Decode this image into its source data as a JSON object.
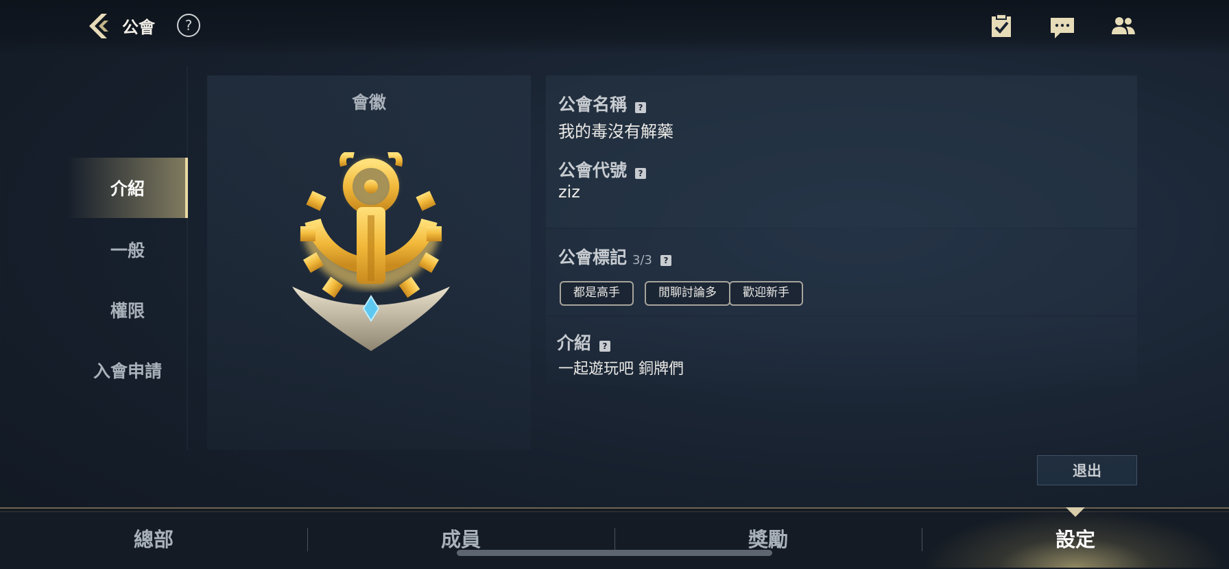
{
  "header": {
    "title": "公會",
    "help_label": "?",
    "icons": [
      "back-icon",
      "help-icon",
      "checklist-icon",
      "chat-icon",
      "friends-icon"
    ]
  },
  "sidebar": {
    "items": [
      {
        "label": "介紹",
        "active": true
      },
      {
        "label": "一般",
        "active": false
      },
      {
        "label": "權限",
        "active": false
      },
      {
        "label": "入會申請",
        "active": false
      }
    ]
  },
  "emblem": {
    "label": "會徽",
    "icon": "guild-emblem-icon",
    "colors": {
      "gold": "#f2b93b",
      "gem": "#5ec8f0",
      "silver": "#cfc6b0"
    }
  },
  "info": {
    "name_label": "公會名稱",
    "name_value": "我的毒沒有解藥",
    "tag_code_label": "公會代號",
    "tag_code_value": "ziz",
    "tags_label": "公會標記",
    "tags_count": "3/3",
    "tags": [
      "都是高手",
      "閒聊討論多",
      "歡迎新手"
    ],
    "intro_label": "介紹",
    "intro_value": "一起遊玩吧 銅牌們",
    "help_glyph": "?"
  },
  "actions": {
    "exit_label": "退出"
  },
  "bottom_tabs": [
    {
      "label": "總部",
      "active": false
    },
    {
      "label": "成員",
      "active": false
    },
    {
      "label": "獎勵",
      "active": false
    },
    {
      "label": "設定",
      "active": true
    }
  ],
  "colors": {
    "accent_gold": "#e9d9a3",
    "background": "#17202d"
  }
}
